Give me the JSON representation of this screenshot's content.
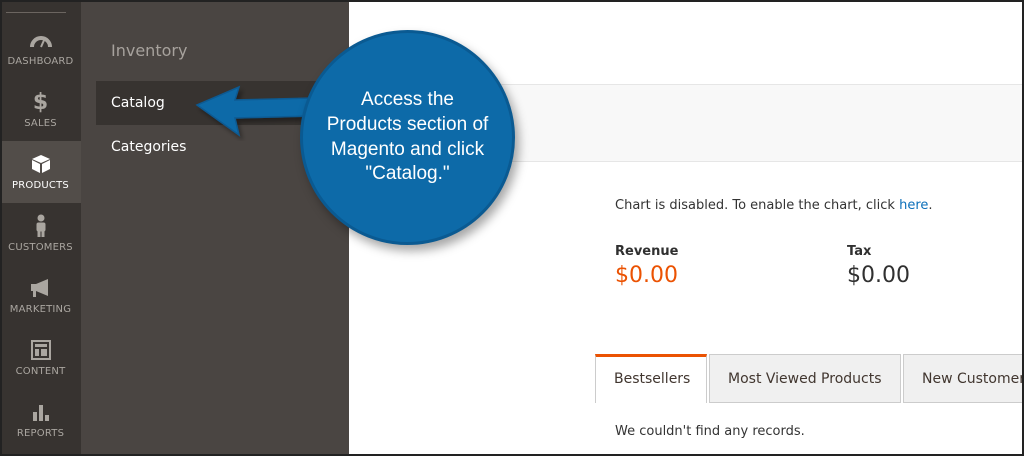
{
  "admin_nav": {
    "items": [
      {
        "label": "DASHBOARD",
        "icon": "dashboard-gauge-icon"
      },
      {
        "label": "SALES",
        "icon": "dollar-icon"
      },
      {
        "label": "PRODUCTS",
        "icon": "box-icon"
      },
      {
        "label": "CUSTOMERS",
        "icon": "person-icon"
      },
      {
        "label": "MARKETING",
        "icon": "megaphone-icon"
      },
      {
        "label": "CONTENT",
        "icon": "layout-icon"
      },
      {
        "label": "REPORTS",
        "icon": "bar-chart-icon"
      }
    ],
    "active": "PRODUCTS"
  },
  "flyout": {
    "section_title": "Inventory",
    "items": [
      {
        "label": "Catalog"
      },
      {
        "label": "Categories"
      }
    ],
    "selected": "Catalog"
  },
  "dashboard": {
    "chart_note_prefix": "Chart is disabled. To enable the chart, click ",
    "chart_note_link": "here",
    "chart_note_suffix": ".",
    "revenue_label": "Revenue",
    "revenue_value": "$0.00",
    "tax_label": "Tax",
    "tax_value": "$0.00",
    "tabs": [
      {
        "label": "Bestsellers"
      },
      {
        "label": "Most Viewed Products"
      },
      {
        "label": "New Customers"
      }
    ],
    "active_tab": "Bestsellers",
    "no_records": "We couldn't find any records."
  },
  "callout": {
    "text": "Access the Products section of Magento and click \"Catalog.\""
  },
  "colors": {
    "nav_bg": "#373330",
    "flyout_bg": "#4a4542",
    "accent_orange": "#eb5202",
    "callout_blue": "#0d6aa8",
    "link_blue": "#0b6fba"
  }
}
